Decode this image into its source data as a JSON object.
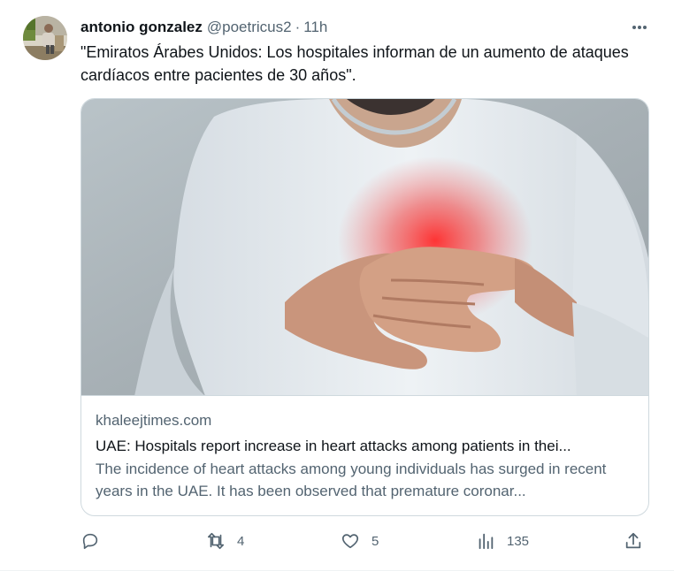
{
  "tweet": {
    "author_name": "antonio gonzalez",
    "handle": "@poetricus2",
    "separator": "·",
    "time": "11h",
    "text": "\"Emiratos Árabes Unidos: Los hospitales informan de un aumento de ataques cardíacos entre pacientes de 30 años\"."
  },
  "card": {
    "domain": "khaleejtimes.com",
    "title": "UAE: Hospitals report increase in heart attacks among patients in thei...",
    "description": "The incidence of heart attacks among young individuals has surged in recent years in the UAE. It has been observed that premature coronar..."
  },
  "actions": {
    "replies": "",
    "retweets": "4",
    "likes": "5",
    "views": "135"
  },
  "icons": {
    "more": "more-icon",
    "reply": "reply-icon",
    "retweet": "retweet-icon",
    "like": "heart-icon",
    "views": "views-icon",
    "share": "share-icon"
  },
  "colors": {
    "text_primary": "#0f1419",
    "text_secondary": "#536471",
    "border": "#cfd9de"
  }
}
